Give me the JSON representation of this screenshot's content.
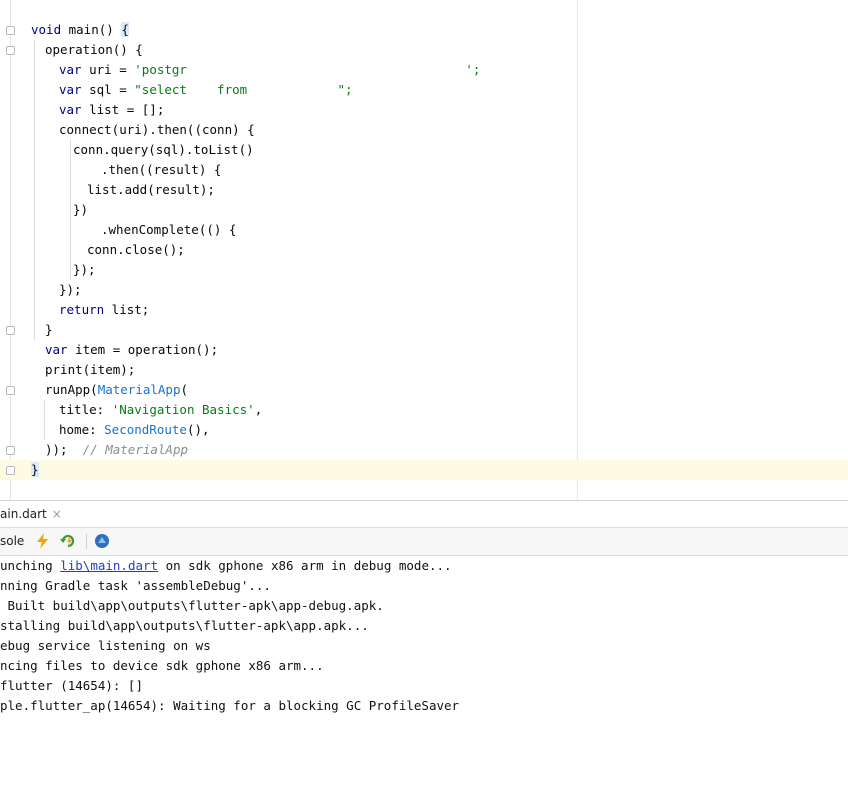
{
  "editor": {
    "lines": [
      {
        "parts": [
          {
            "t": "void",
            "c": "kw"
          },
          {
            "t": " main() ",
            "c": ""
          },
          {
            "t": "{",
            "c": "brace-hl"
          }
        ]
      },
      {
        "parts": [
          {
            "t": "operation() {",
            "c": ""
          }
        ]
      },
      {
        "parts": [
          {
            "t": "var",
            "c": "kw"
          },
          {
            "t": " uri = ",
            "c": ""
          },
          {
            "t": "'postgr",
            "c": "str"
          },
          {
            "t": "                                     ",
            "c": ""
          },
          {
            "t": "';",
            "c": "str"
          }
        ]
      },
      {
        "parts": [
          {
            "t": "var",
            "c": "kw"
          },
          {
            "t": " sql = ",
            "c": ""
          },
          {
            "t": "\"select    from            \";",
            "c": "str"
          }
        ]
      },
      {
        "parts": [
          {
            "t": "var",
            "c": "kw"
          },
          {
            "t": " list = [];",
            "c": ""
          }
        ]
      },
      {
        "parts": [
          {
            "t": "connect(uri).then((conn) {",
            "c": ""
          }
        ]
      },
      {
        "parts": [
          {
            "t": "conn.query(sql).toList()",
            "c": ""
          }
        ]
      },
      {
        "parts": [
          {
            "t": ".then((result) {",
            "c": ""
          }
        ]
      },
      {
        "parts": [
          {
            "t": "list.add(result);",
            "c": ""
          }
        ]
      },
      {
        "parts": [
          {
            "t": "})",
            "c": ""
          }
        ]
      },
      {
        "parts": [
          {
            "t": ".whenComplete(() {",
            "c": ""
          }
        ]
      },
      {
        "parts": [
          {
            "t": "conn.close();",
            "c": ""
          }
        ]
      },
      {
        "parts": [
          {
            "t": "});",
            "c": ""
          }
        ]
      },
      {
        "parts": [
          {
            "t": "});",
            "c": ""
          }
        ]
      },
      {
        "parts": [
          {
            "t": "return",
            "c": "kw"
          },
          {
            "t": " list;",
            "c": ""
          }
        ]
      },
      {
        "parts": [
          {
            "t": "}",
            "c": ""
          }
        ]
      },
      {
        "parts": [
          {
            "t": "var",
            "c": "kw"
          },
          {
            "t": " item = operation();",
            "c": ""
          }
        ]
      },
      {
        "parts": [
          {
            "t": "print(item);",
            "c": ""
          }
        ]
      },
      {
        "parts": [
          {
            "t": "runApp(",
            "c": ""
          },
          {
            "t": "MaterialApp",
            "c": "cls"
          },
          {
            "t": "(",
            "c": ""
          }
        ]
      },
      {
        "parts": [
          {
            "t": "title: ",
            "c": ""
          },
          {
            "t": "'Navigation Basics'",
            "c": "str"
          },
          {
            "t": ",",
            "c": ""
          }
        ]
      },
      {
        "parts": [
          {
            "t": "home: ",
            "c": ""
          },
          {
            "t": "SecondRoute",
            "c": "cls"
          },
          {
            "t": "(),",
            "c": ""
          }
        ]
      },
      {
        "parts": [
          {
            "t": "));  ",
            "c": ""
          },
          {
            "t": "// MaterialApp",
            "c": "cmt"
          }
        ]
      },
      {
        "parts": [
          {
            "t": "}",
            "c": "brace-hl"
          }
        ]
      }
    ]
  },
  "run_panel": {
    "tab_label": "ain.dart",
    "tab_close": "×",
    "toolbar_label": "sole",
    "icons": [
      "hot-reload-icon",
      "hot-restart-icon",
      "devtools-icon"
    ]
  },
  "console": {
    "lines": [
      {
        "parts": [
          {
            "t": "unching ",
            "c": ""
          },
          {
            "t": "lib\\main.dart",
            "c": "link"
          },
          {
            "t": " on sdk gphone x86 arm in debug mode...",
            "c": ""
          }
        ]
      },
      {
        "parts": [
          {
            "t": "nning Gradle task 'assembleDebug'...",
            "c": ""
          }
        ]
      },
      {
        "parts": [
          {
            "t": " Built build\\app\\outputs\\flutter-apk\\app-debug.apk.",
            "c": ""
          }
        ]
      },
      {
        "parts": [
          {
            "t": "stalling build\\app\\outputs\\flutter-apk\\app.apk...",
            "c": ""
          }
        ]
      },
      {
        "parts": [
          {
            "t": "ebug service listening on ws",
            "c": ""
          }
        ]
      },
      {
        "parts": [
          {
            "t": "ncing files to device sdk gphone x86 arm...",
            "c": ""
          }
        ]
      },
      {
        "parts": [
          {
            "t": "flutter (14654): []",
            "c": ""
          }
        ]
      },
      {
        "parts": [
          {
            "t": "ple.flutter_ap(14654): Waiting for a blocking GC ProfileSaver",
            "c": ""
          }
        ]
      }
    ]
  },
  "colors": {
    "keyword": "#000080",
    "string": "#067d17",
    "class": "#1a73d0",
    "comment": "#8c8c8c",
    "link": "#1f3fbf",
    "caret_row": "#fdfbe3"
  }
}
